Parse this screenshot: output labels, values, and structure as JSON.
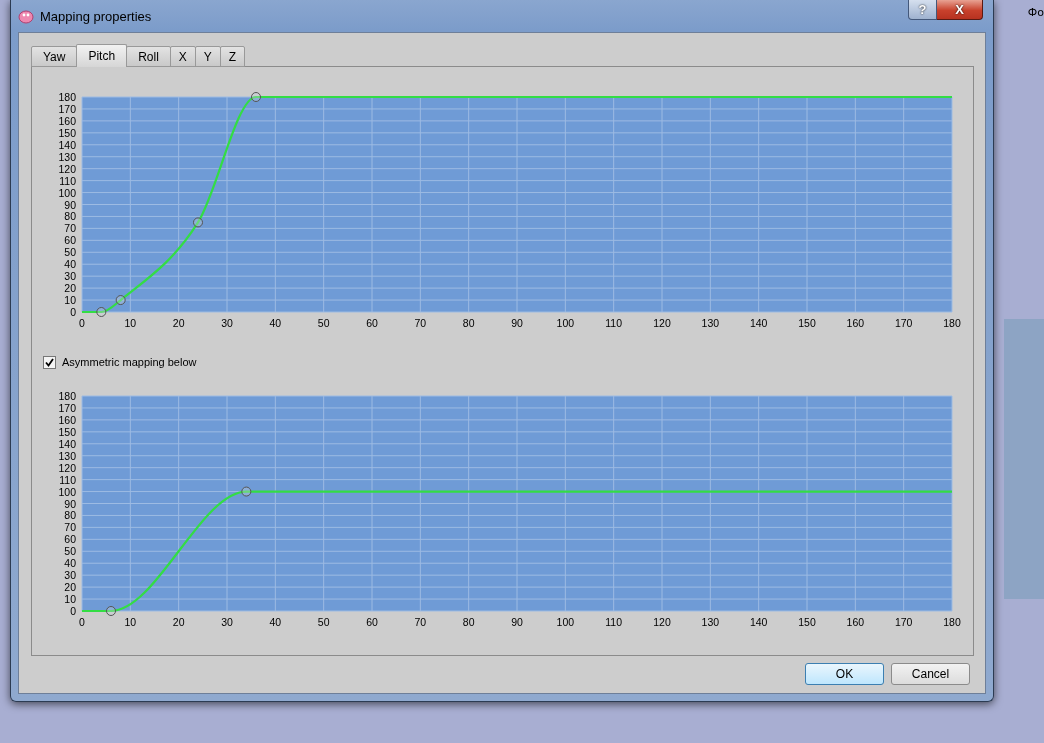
{
  "window": {
    "title": "Mapping properties",
    "help_button": "?",
    "close_button": "X"
  },
  "tabs": [
    {
      "label": "Yaw",
      "selected": false
    },
    {
      "label": "Pitch",
      "selected": true
    },
    {
      "label": "Roll",
      "selected": false
    },
    {
      "label": "X",
      "selected": false
    },
    {
      "label": "Y",
      "selected": false
    },
    {
      "label": "Z",
      "selected": false
    }
  ],
  "upper_chart": {
    "chart_data": {
      "type": "line",
      "grid": true,
      "x": [
        0,
        4,
        8,
        24,
        36,
        180
      ],
      "series": [
        {
          "color": "#33dd44",
          "values": [
            0,
            0,
            10,
            75,
            180,
            180
          ]
        }
      ],
      "xlim": [
        0,
        180
      ],
      "ylim": [
        0,
        180
      ],
      "xticks": [
        0,
        10,
        20,
        30,
        40,
        50,
        60,
        70,
        80,
        90,
        100,
        110,
        120,
        130,
        140,
        150,
        160,
        170,
        180
      ],
      "yticks": [
        0,
        10,
        20,
        30,
        40,
        50,
        60,
        70,
        80,
        90,
        100,
        110,
        120,
        130,
        140,
        150,
        160,
        170,
        180
      ]
    }
  },
  "asymmetric_checkbox": {
    "label": "Asymmetric mapping below",
    "checked": true
  },
  "lower_chart": {
    "chart_data": {
      "type": "line",
      "grid": true,
      "x": [
        0,
        6,
        34,
        180
      ],
      "series": [
        {
          "color": "#33dd44",
          "values": [
            0,
            0,
            100,
            100
          ]
        }
      ],
      "xlim": [
        0,
        180
      ],
      "ylim": [
        0,
        180
      ],
      "xticks": [
        0,
        10,
        20,
        30,
        40,
        50,
        60,
        70,
        80,
        90,
        100,
        110,
        120,
        130,
        140,
        150,
        160,
        170,
        180
      ],
      "yticks": [
        0,
        10,
        20,
        30,
        40,
        50,
        60,
        70,
        80,
        90,
        100,
        110,
        120,
        130,
        140,
        150,
        160,
        170,
        180
      ]
    }
  },
  "buttons": [
    {
      "label": "OK",
      "selected": true
    },
    {
      "label": "Cancel",
      "selected": false
    }
  ],
  "desktop": {
    "corner_text": "Фо"
  }
}
